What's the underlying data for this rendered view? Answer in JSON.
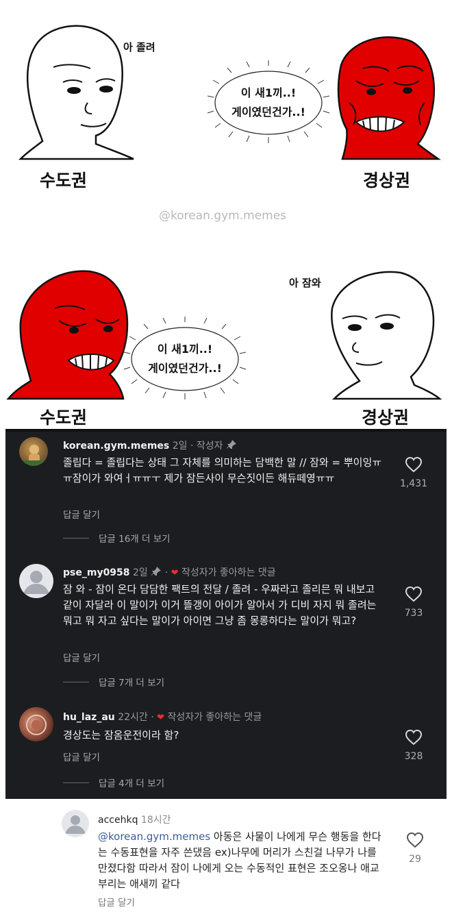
{
  "meme_top": {
    "thought": "아 졸려",
    "bubble_line1": "이 새1끼..!",
    "bubble_line2": "게이였던건가..!",
    "left_region": "수도권",
    "right_region": "경상권",
    "watermark": "@korean.gym.memes"
  },
  "meme_bottom": {
    "thought": "아 잠와",
    "bubble_line1": "이 새1끼..!",
    "bubble_line2": "게이였던건가..!",
    "left_region": "수도권",
    "right_region": "경상권"
  },
  "comments": [
    {
      "username": "korean.gym.memes",
      "time": "2일",
      "sub": "· 작성자",
      "avatar_icon": "cat-photo",
      "text": "졸립다 = 졸립다는 상태 그 자체를 의미하는 담백한 말 // 잠와 = 뿌이잉ㅠㅠ잠이가 와여ㅓㅠㅠㅜ 제가 잠든사이 무슨짓이든 해듀떼영ㅠㅠ",
      "reply_label": "답글 달기",
      "more_replies": "답글 16개 더 보기",
      "likes": "1,431"
    },
    {
      "username": "pse_my0958",
      "time": "2일",
      "sub": "작성자가 좋아하는 댓글",
      "avatar_icon": "default-avatar",
      "text": "잠 와 - 잠이 온다 담담한 팩트의 전달 / 졸려 - 우짜라고 졸리믄 뭐 내보고 같이 자달라 이 말이가 이거 뜰갱이 아이가 알아서 가 디비 자지 뭐 졸려는 뭐고 뭐 자고 싶다는 말이가 아이면 그냥 좀 몽롱하다는 말이가 뭐고?",
      "reply_label": "답글 달기",
      "more_replies": "답글 7개 더 보기",
      "likes": "733"
    },
    {
      "username": "hu_laz_au",
      "time": "22시간",
      "sub": "작성자가 좋아하는 댓글",
      "avatar_icon": "photo-avatar",
      "text": "경상도는 잠옴운전이라 함?",
      "reply_label": "답글 달기",
      "more_replies": "답글 4개 더 보기",
      "likes": "328"
    }
  ],
  "reply_comment": {
    "username": "accehkq",
    "time": "18시간",
    "mention": "@korean.gym.memes",
    "text": " 아동은 사물이 나에게 무슨 행동을 한다는 수동표현을 자주 쓴댔음 ex)나무에 머리가 스친걸 나무가 나를 만졌다함 따라서 잠이 나에게 오는 수동적인 표현은 조오옹나 애교부리는 애새끼 같다",
    "reply_label": "답글 달기",
    "likes": "29"
  },
  "colors": {
    "rage_red": "#e00000",
    "dark_bg": "#1c1d20",
    "heart_red": "#ef2b3a",
    "mention_blue": "#3b5a9a"
  }
}
